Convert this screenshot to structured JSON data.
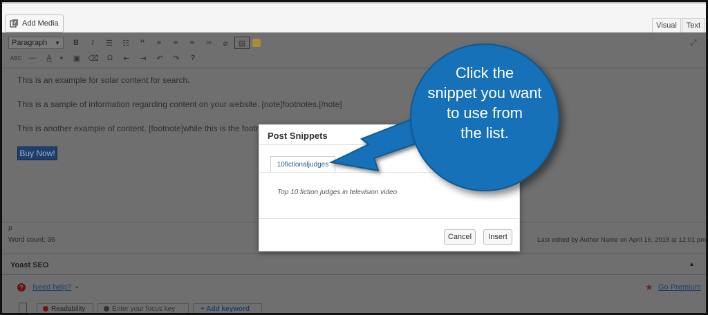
{
  "toolbar_top": {
    "add_media": "Add Media",
    "tab_visual": "Visual",
    "tab_text": "Text"
  },
  "format_select": "Paragraph",
  "editor": {
    "line1": "This is an example for solar content for search.",
    "line2": "This is a sample of information regarding content on your website. [note]footnotes.[/note]",
    "line3": "This is another example of content. [footnote]while this is the footno",
    "button": "Buy Now!"
  },
  "status": {
    "path": "p",
    "word_count": "Word count: 36",
    "last_edited": "Last edited by Author Name on April 16, 2018 at 12:01 pm"
  },
  "yoast": {
    "title": "Yoast SEO",
    "need_help": "Need help?",
    "go_premium": "Go Premium",
    "readability": "Readability",
    "focus_placeholder": "Enter your focus key",
    "add_keyword": "+ Add keyword"
  },
  "dialog": {
    "title": "Post Snippets",
    "snippet_tab": "10fictionaljudges",
    "description": "Top 10 fiction judges in television video",
    "cancel": "Cancel",
    "insert": "Insert"
  },
  "callout": {
    "lines": [
      "Click the",
      "snippet you want",
      "to use from",
      "the list."
    ],
    "color": "#1671b8"
  }
}
